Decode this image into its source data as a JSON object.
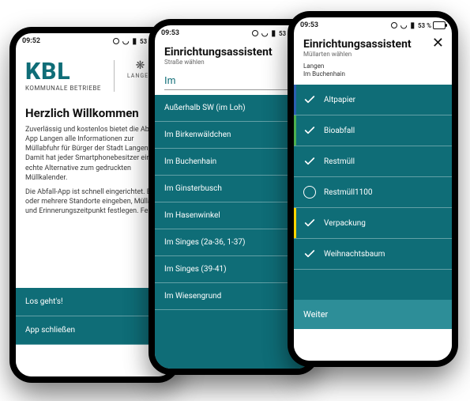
{
  "statusbar": {
    "time1": "09:52",
    "time2": "09:53",
    "time3": "09:53",
    "battery": "53 %"
  },
  "phone1": {
    "brand_main": "KBL",
    "brand_sub": "KOMMUNALE BETRIEBE",
    "crest_label": "LANGEN",
    "heading": "Herzlich Willkommen",
    "para1": "Zuverlässig und kostenlos bietet die Abfall-App Langen alle Informationen zur Müllabfuhr für Bürger der Stadt Langen. Damit hat jeder Smartphonebesitzer eine echte Alternative zum gedruckten Müllkalender.",
    "para2": "Die Abfall-App ist schnell eingerichtet. Einen oder mehrere Standorte eingeben, Müllarten und Erinnerungszeitpunkt festlegen. Fertig.",
    "action_start": "Los geht's!",
    "action_close": "App schließen"
  },
  "phone2": {
    "title": "Einrichtungsassistent",
    "subtitle": "Straße wählen",
    "input_value": "Im",
    "options": [
      "Außerhalb SW (im Loh)",
      "Im Birkenwäldchen",
      "Im Buchenhain",
      "Im Ginsterbusch",
      "Im Hasenwinkel",
      "Im Singes (2a-36, 1-37)",
      "Im Singes (39-41)",
      "Im Wiesengrund"
    ]
  },
  "phone3": {
    "title": "Einrichtungsassistent",
    "subtitle": "Müllarten wählen",
    "context_city": "Langen",
    "context_street": "Im Buchenhain",
    "items": [
      {
        "label": "Altpapier",
        "state": "checked",
        "stripe": "blue"
      },
      {
        "label": "Bioabfall",
        "state": "checked",
        "stripe": "green"
      },
      {
        "label": "Restmüll",
        "state": "checked",
        "stripe": ""
      },
      {
        "label": "Restmüll1100",
        "state": "unchecked",
        "stripe": ""
      },
      {
        "label": "Verpackung",
        "state": "checked",
        "stripe": "yellow"
      },
      {
        "label": "Weihnachtsbaum",
        "state": "checked",
        "stripe": ""
      }
    ],
    "next": "Weiter"
  }
}
